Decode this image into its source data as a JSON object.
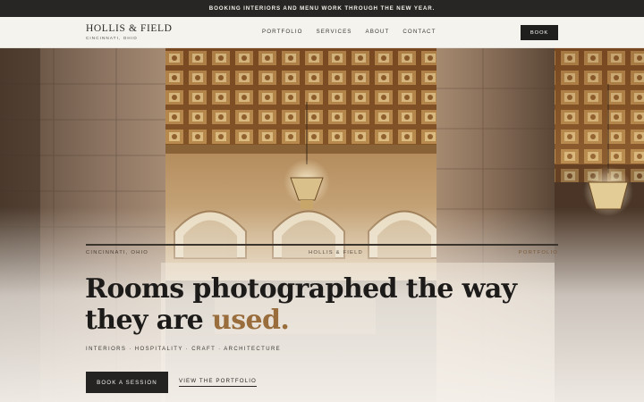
{
  "announcement": "BOOKING INTERIORS AND MENU WORK THROUGH THE NEW YEAR.",
  "header": {
    "brand_name": "HOLLIS & FIELD",
    "brand_sub": "CINCINNATI, OHIO",
    "nav": [
      "PORTFOLIO",
      "SERVICES",
      "ABOUT",
      "CONTACT"
    ],
    "book_label": "BOOK"
  },
  "hero": {
    "meta_left": "CINCINNATI, OHIO",
    "meta_center": "HOLLIS & FIELD",
    "meta_right": "PORTFOLIO",
    "headline_start": "Rooms photographed the way they are ",
    "headline_accent": "used.",
    "tags": "INTERIORS · HOSPITALITY · CRAFT · ARCHITECTURE",
    "cta_primary": "BOOK A SESSION",
    "cta_secondary": "VIEW THE PORTFOLIO"
  },
  "colors": {
    "accent": "#9a6d3c",
    "dark": "#242322",
    "header_bg": "#f5f3ee"
  }
}
